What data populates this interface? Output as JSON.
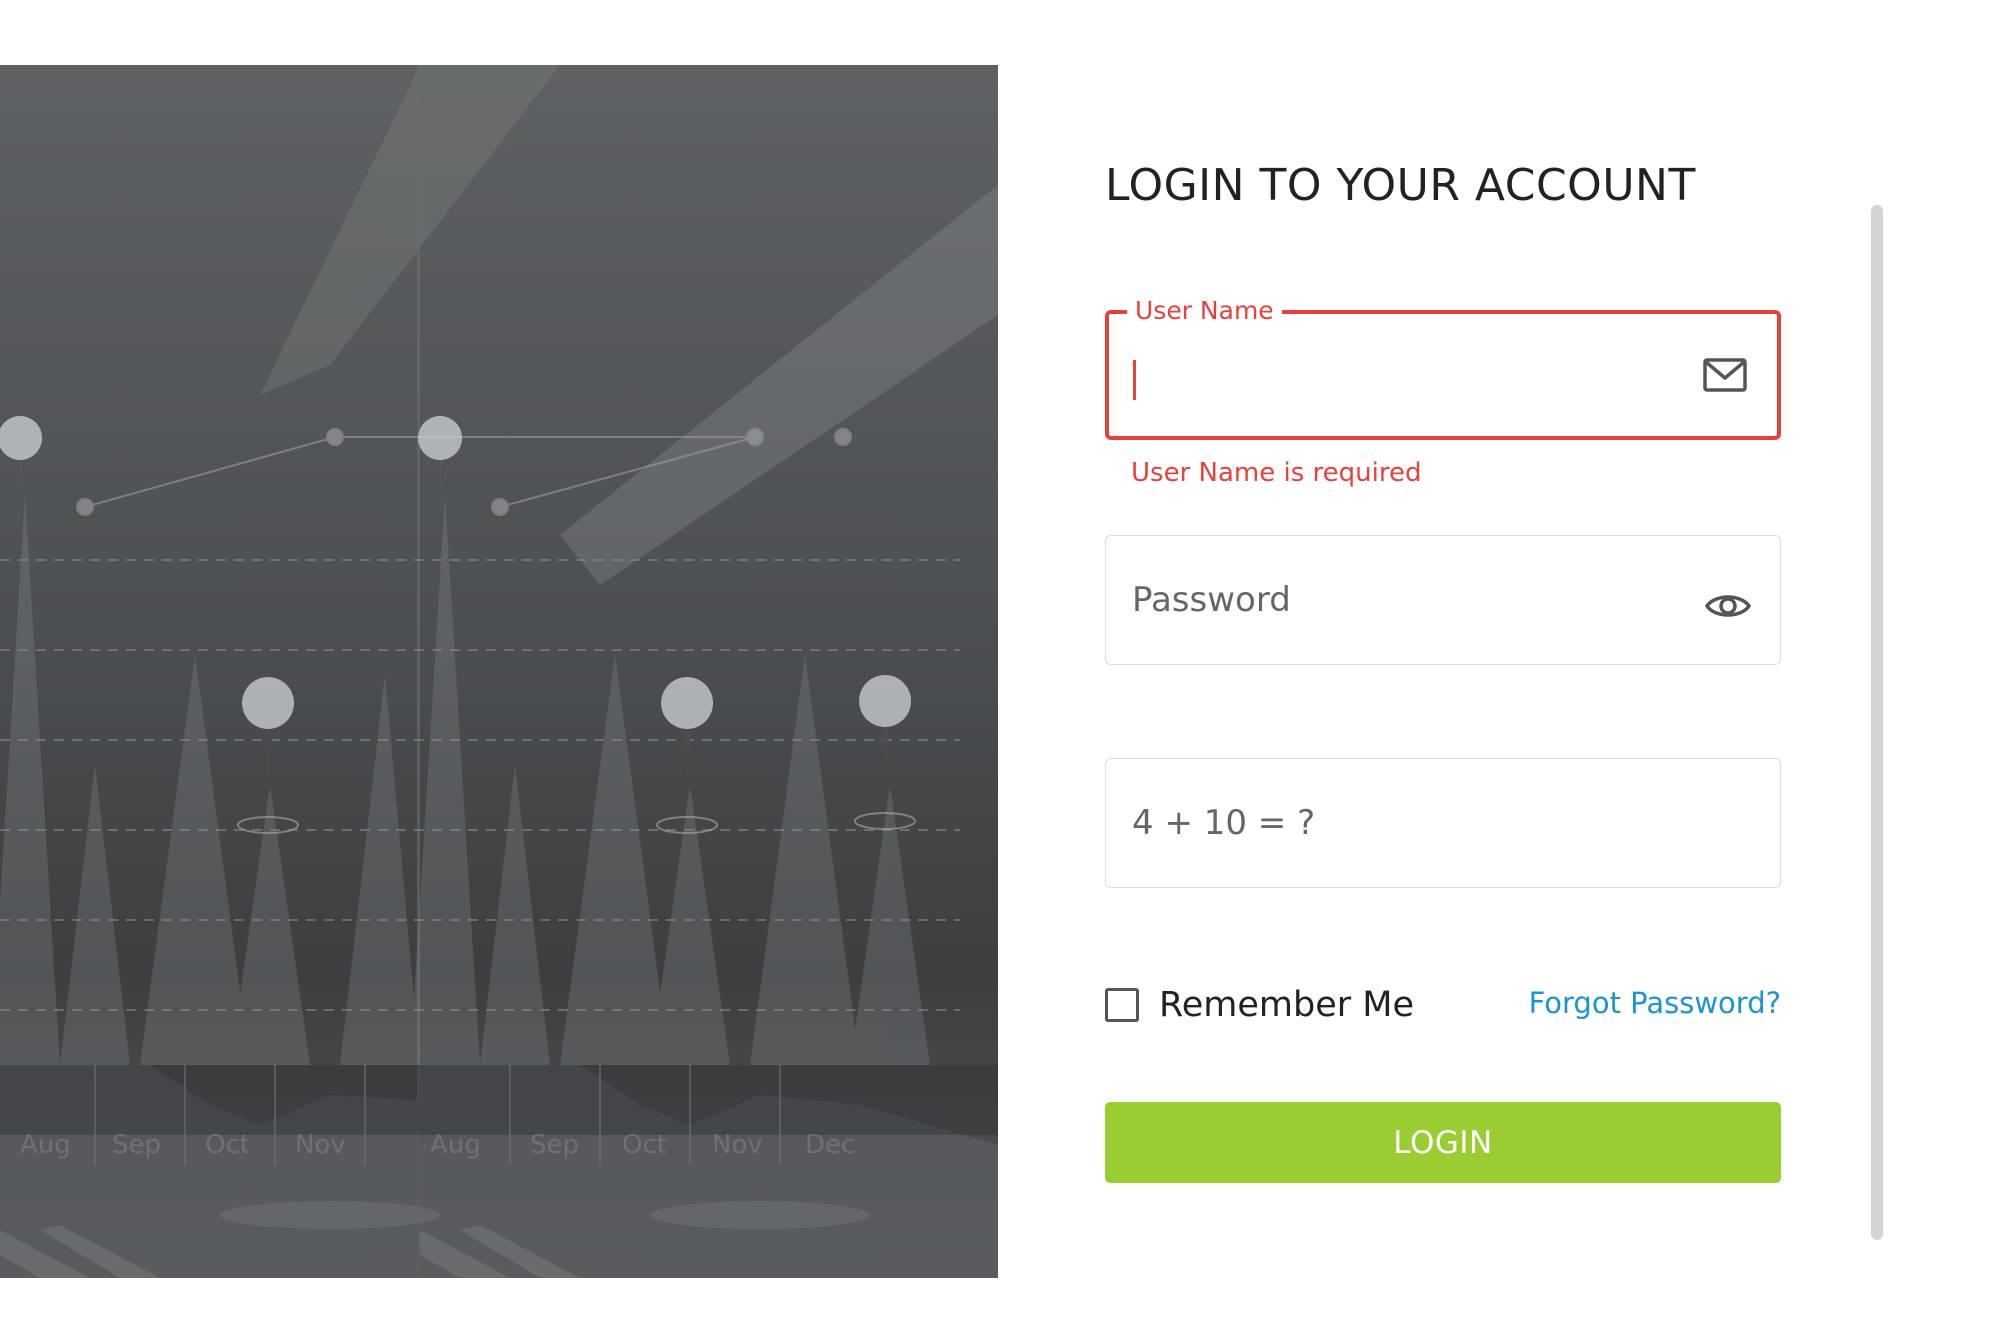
{
  "login": {
    "title": "LOGIN TO YOUR ACCOUNT",
    "username": {
      "label": "User Name",
      "value": "",
      "error": "User Name is required"
    },
    "password": {
      "placeholder": "Password",
      "value": ""
    },
    "captcha": {
      "placeholder": "4 + 10 = ?",
      "value": ""
    },
    "remember_me": {
      "label": "Remember Me",
      "checked": false
    },
    "forgot_password": "Forgot Password?",
    "submit_label": "LOGIN"
  },
  "icons": {
    "username": "mail-icon",
    "password": "eye-icon"
  },
  "colors": {
    "error": "#e8413b",
    "accent_button": "#9acd32",
    "link": "#1b94d2"
  },
  "background_chart_labels": [
    "Aug",
    "Sep",
    "Oct",
    "Nov",
    "Dec"
  ]
}
